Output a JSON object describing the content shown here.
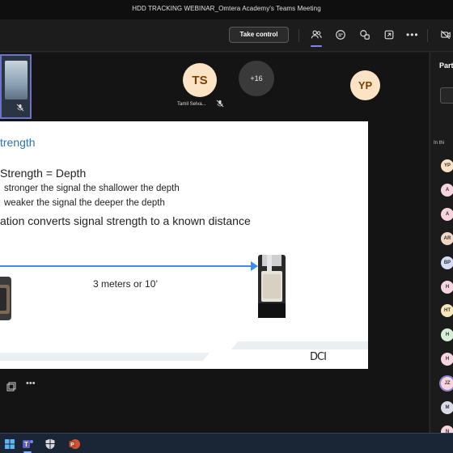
{
  "window": {
    "title": "HDD TRACKING WEBINAR_Omtera Academy's Teams Meeting"
  },
  "toolbar": {
    "take_control_label": "Take control",
    "buttons": [
      {
        "icon": "people-icon",
        "active": true
      },
      {
        "icon": "chat-icon"
      },
      {
        "icon": "react-icon"
      },
      {
        "icon": "share-tray-icon"
      },
      {
        "icon": "more-icon"
      },
      {
        "icon": "camera-off-icon"
      }
    ]
  },
  "participants_strip": [
    {
      "initials": "TS",
      "name": "Tamil Selva...",
      "muted": true
    },
    {
      "initials": "+16"
    },
    {
      "initials": "YP"
    }
  ],
  "slide": {
    "heading": "trength",
    "line1": "Strength = Depth",
    "line2": "stronger the signal the shallower the depth",
    "line3": "weaker the signal the deeper the depth",
    "line4": "ation converts signal strength to a known distance",
    "distance_label": "3 meters or 10’",
    "logo": "DCI"
  },
  "side_panel": {
    "title": "Part",
    "section_label": "In thi",
    "people": [
      {
        "initials": "YP",
        "color": "#fde3c5"
      },
      {
        "initials": "A",
        "color": "#f7d4de"
      },
      {
        "initials": "A",
        "color": "#f7d4de"
      },
      {
        "initials": "AR",
        "color": "#f3d6c4"
      },
      {
        "initials": "BP",
        "color": "#d5dcf7"
      },
      {
        "initials": "H",
        "color": "#f7d4de"
      },
      {
        "initials": "HT",
        "color": "#f7e6b8"
      },
      {
        "initials": "H",
        "color": "#d4eed8"
      },
      {
        "initials": "H",
        "color": "#f7d4de"
      },
      {
        "initials": "JZ",
        "color": "#f7d4de"
      },
      {
        "initials": "M",
        "color": "#d9d9e8"
      },
      {
        "initials": "N",
        "color": "#f7d4de"
      }
    ]
  },
  "taskbar": {
    "apps": [
      {
        "icon": "windows-start-icon"
      },
      {
        "icon": "teams-icon",
        "active": true
      },
      {
        "icon": "defender-icon"
      },
      {
        "icon": "powerpoint-icon"
      }
    ]
  }
}
